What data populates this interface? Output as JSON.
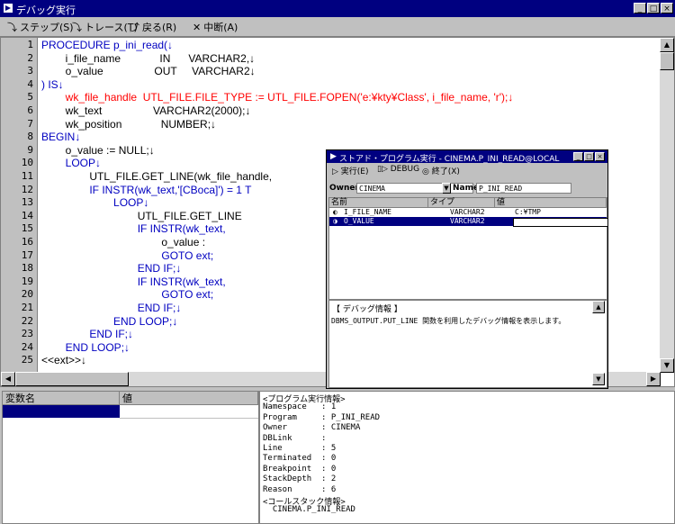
{
  "window": {
    "title": "デバッグ実行",
    "min": "_",
    "max": "□",
    "close": "×"
  },
  "toolbar": {
    "step": "ステップ(S)",
    "trace": "トレース(T)",
    "back": "戻る(R)",
    "abort": "中断(A)"
  },
  "code_lines": [
    {
      "n": "1",
      "segs": [
        {
          "t": "PROCEDURE p_ini_read(↓",
          "c": "blue"
        }
      ]
    },
    {
      "n": "2",
      "segs": [
        {
          "t": "        i_file_name             IN      VARCHAR2,↓",
          "c": "black"
        }
      ]
    },
    {
      "n": "3",
      "segs": [
        {
          "t": "        o_value                 OUT     VARCHAR2↓",
          "c": "black"
        }
      ]
    },
    {
      "n": "4",
      "segs": [
        {
          "t": ") IS↓",
          "c": "blue"
        }
      ]
    },
    {
      "n": "5",
      "segs": [
        {
          "t": "        wk_file_handle  UTL_FILE.FILE_TYPE := UTL_FILE.FOPEN('e:¥kty¥Class', i_file_name, 'r');↓",
          "c": "red"
        }
      ]
    },
    {
      "n": "6",
      "segs": [
        {
          "t": "        wk_text                 VARCHAR2(2000);↓",
          "c": "black"
        }
      ]
    },
    {
      "n": "7",
      "segs": [
        {
          "t": "        wk_position             NUMBER;↓",
          "c": "black"
        }
      ]
    },
    {
      "n": "8",
      "segs": [
        {
          "t": "BEGIN↓",
          "c": "blue"
        }
      ]
    },
    {
      "n": "9",
      "segs": [
        {
          "t": "        o_value := NULL;↓",
          "c": "black"
        }
      ]
    },
    {
      "n": "10",
      "segs": [
        {
          "t": "        LOOP↓",
          "c": "blue"
        }
      ]
    },
    {
      "n": "11",
      "segs": [
        {
          "t": "                UTL_FILE.GET_LINE(wk_file_handle,",
          "c": "black"
        }
      ]
    },
    {
      "n": "12",
      "segs": [
        {
          "t": "                IF INSTR(wk_text,'[CBoca]') = 1 T",
          "c": "blue"
        }
      ]
    },
    {
      "n": "13",
      "segs": [
        {
          "t": "                        LOOP↓",
          "c": "blue"
        }
      ]
    },
    {
      "n": "14",
      "segs": [
        {
          "t": "                                UTL_FILE.GET_LINE",
          "c": "black"
        }
      ]
    },
    {
      "n": "15",
      "segs": [
        {
          "t": "                                IF INSTR(wk_text,",
          "c": "blue"
        }
      ]
    },
    {
      "n": "16",
      "segs": [
        {
          "t": "                                        o_value :",
          "c": "black"
        }
      ]
    },
    {
      "n": "17",
      "segs": [
        {
          "t": "                                        GOTO ext;",
          "c": "blue"
        }
      ]
    },
    {
      "n": "18",
      "segs": [
        {
          "t": "                                END IF;↓",
          "c": "blue"
        }
      ]
    },
    {
      "n": "19",
      "segs": [
        {
          "t": "                                IF INSTR(wk_text,",
          "c": "blue"
        }
      ]
    },
    {
      "n": "20",
      "segs": [
        {
          "t": "                                        GOTO ext;",
          "c": "blue"
        }
      ]
    },
    {
      "n": "21",
      "segs": [
        {
          "t": "                                END IF;↓",
          "c": "blue"
        }
      ]
    },
    {
      "n": "22",
      "segs": [
        {
          "t": "                        END LOOP;↓",
          "c": "blue"
        }
      ]
    },
    {
      "n": "23",
      "segs": [
        {
          "t": "                END IF;↓",
          "c": "blue"
        }
      ]
    },
    {
      "n": "24",
      "segs": [
        {
          "t": "        END LOOP;↓",
          "c": "blue"
        }
      ]
    },
    {
      "n": "25",
      "segs": [
        {
          "t": "<<ext>>↓",
          "c": "black"
        }
      ]
    }
  ],
  "popup": {
    "title": "ストアド・プログラム実行 - CINEMA.P_INI_READ@LOCAL",
    "run": "実行(E)",
    "debug": "DEBUG",
    "quit": "終了(X)",
    "owner_label": "Owner",
    "owner_value": "CINEMA",
    "name_label": "Name",
    "name_value": "P_INI_READ",
    "columns": [
      "名前",
      "タイプ",
      "値"
    ],
    "rows": [
      {
        "name": "I_FILE_NAME",
        "type": "VARCHAR2",
        "value": "C:¥TMP"
      },
      {
        "name": "O_VALUE",
        "type": "VARCHAR2",
        "value": ""
      }
    ],
    "info_title": "【 デバッグ情報 】",
    "info_text": "DBMS_OUTPUT.PUT_LINE 関数を利用したデバッグ情報を表示します。"
  },
  "variables": {
    "col_name": "変数名",
    "col_value": "値"
  },
  "exec_info": [
    "<プログラム実行情報>",
    "Namespace   : 1",
    "Program     : P_INI_READ",
    "Owner       : CINEMA",
    "DBLink      :",
    "Line        : 5",
    "Terminated  : 0",
    "Breakpoint  : 0",
    "StackDepth  : 2",
    "Reason      : 6",
    "<コールスタック情報>",
    "  CINEMA.P_INI_READ"
  ],
  "colors": {
    "title_bg": "#000080",
    "keyword": "#0000c0",
    "current_line": "#ff0000",
    "face": "#c0c0c0"
  }
}
